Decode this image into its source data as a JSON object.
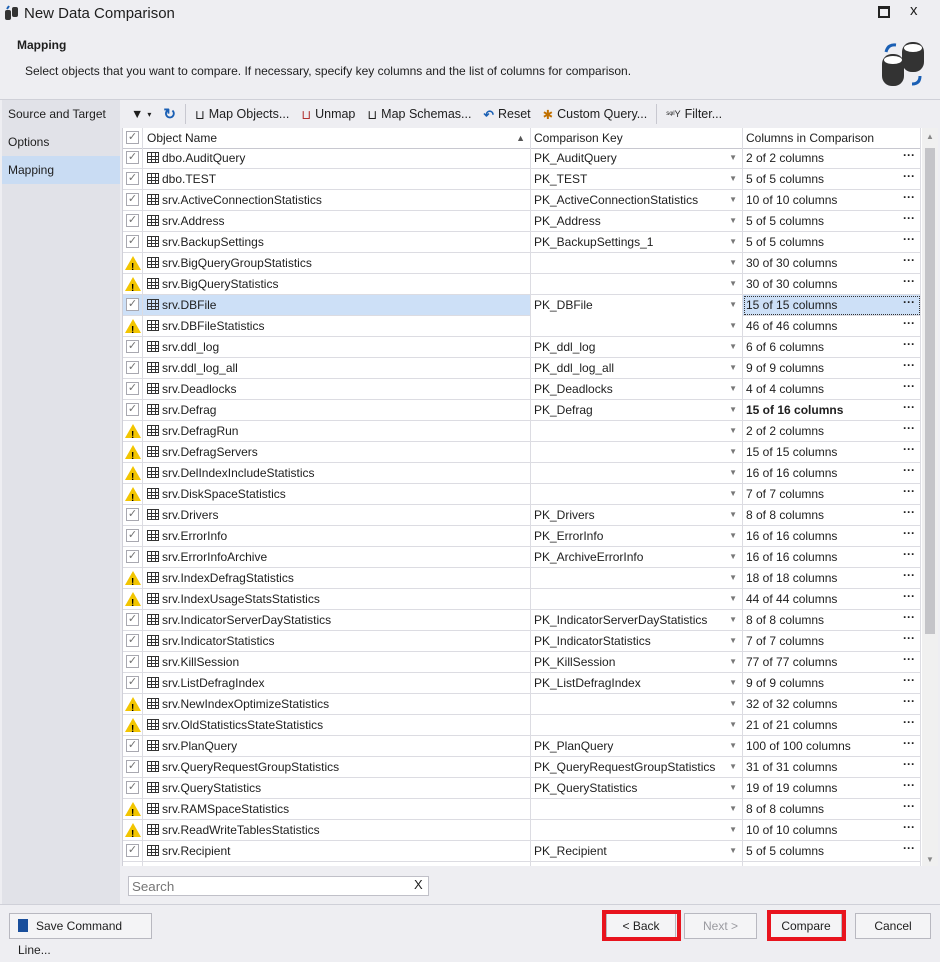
{
  "window": {
    "title": "New Data Comparison"
  },
  "header": {
    "section": "Mapping",
    "description": "Select objects that you want to compare. If necessary, specify key columns and the list of columns for comparison."
  },
  "nav": {
    "items": [
      {
        "label": "Source and Target"
      },
      {
        "label": "Options"
      },
      {
        "label": "Mapping",
        "selected": true
      }
    ]
  },
  "toolbar": {
    "map_objects": "Map Objects...",
    "unmap": "Unmap",
    "map_schemas": "Map Schemas...",
    "reset": "Reset",
    "custom_query": "Custom Query...",
    "filter": "Filter..."
  },
  "grid": {
    "columns": [
      "Object Name",
      "Comparison Key",
      "Columns in Comparison"
    ],
    "rows": [
      {
        "status": "checked",
        "name": "dbo.AuditQuery",
        "key": "PK_AuditQuery",
        "cols": "2 of 2 columns"
      },
      {
        "status": "checked",
        "name": "dbo.TEST",
        "key": "PK_TEST",
        "cols": "5 of 5 columns"
      },
      {
        "status": "checked",
        "name": "srv.ActiveConnectionStatistics",
        "key": "PK_ActiveConnectionStatistics",
        "cols": "10 of 10 columns"
      },
      {
        "status": "checked",
        "name": "srv.Address",
        "key": "PK_Address",
        "cols": "5 of 5 columns"
      },
      {
        "status": "checked",
        "name": "srv.BackupSettings",
        "key": "PK_BackupSettings_1",
        "cols": "5 of 5 columns"
      },
      {
        "status": "warning",
        "name": "srv.BigQueryGroupStatistics",
        "key": "",
        "cols": "30 of 30 columns"
      },
      {
        "status": "warning",
        "name": "srv.BigQueryStatistics",
        "key": "",
        "cols": "30 of 30 columns"
      },
      {
        "status": "checked",
        "name": "srv.DBFile",
        "key": "PK_DBFile",
        "cols": "15 of 15 columns",
        "selected": true
      },
      {
        "status": "warning",
        "name": "srv.DBFileStatistics",
        "key": "",
        "cols": "46 of 46 columns"
      },
      {
        "status": "checked",
        "name": "srv.ddl_log",
        "key": "PK_ddl_log",
        "cols": "6 of 6 columns"
      },
      {
        "status": "checked",
        "name": "srv.ddl_log_all",
        "key": "PK_ddl_log_all",
        "cols": "9 of 9 columns"
      },
      {
        "status": "checked",
        "name": "srv.Deadlocks",
        "key": "PK_Deadlocks",
        "cols": "4 of 4 columns"
      },
      {
        "status": "checked",
        "name": "srv.Defrag",
        "key": "PK_Defrag",
        "cols": "15 of 16 columns",
        "bold": true
      },
      {
        "status": "warning",
        "name": "srv.DefragRun",
        "key": "",
        "cols": "2 of 2 columns"
      },
      {
        "status": "warning",
        "name": "srv.DefragServers",
        "key": "",
        "cols": "15 of 15 columns"
      },
      {
        "status": "warning",
        "name": "srv.DelIndexIncludeStatistics",
        "key": "",
        "cols": "16 of 16 columns"
      },
      {
        "status": "warning",
        "name": "srv.DiskSpaceStatistics",
        "key": "",
        "cols": "7 of 7 columns"
      },
      {
        "status": "checked",
        "name": "srv.Drivers",
        "key": "PK_Drivers",
        "cols": "8 of 8 columns"
      },
      {
        "status": "checked",
        "name": "srv.ErrorInfo",
        "key": "PK_ErrorInfo",
        "cols": "16 of 16 columns"
      },
      {
        "status": "checked",
        "name": "srv.ErrorInfoArchive",
        "key": "PK_ArchiveErrorInfo",
        "cols": "16 of 16 columns"
      },
      {
        "status": "warning",
        "name": "srv.IndexDefragStatistics",
        "key": "",
        "cols": "18 of 18 columns"
      },
      {
        "status": "warning",
        "name": "srv.IndexUsageStatsStatistics",
        "key": "",
        "cols": "44 of 44 columns"
      },
      {
        "status": "checked",
        "name": "srv.IndicatorServerDayStatistics",
        "key": "PK_IndicatorServerDayStatistics",
        "cols": "8 of 8 columns"
      },
      {
        "status": "checked",
        "name": "srv.IndicatorStatistics",
        "key": "PK_IndicatorStatistics",
        "cols": "7 of 7 columns"
      },
      {
        "status": "checked",
        "name": "srv.KillSession",
        "key": "PK_KillSession",
        "cols": "77 of 77 columns"
      },
      {
        "status": "checked",
        "name": "srv.ListDefragIndex",
        "key": "PK_ListDefragIndex",
        "cols": "9 of 9 columns"
      },
      {
        "status": "warning",
        "name": "srv.NewIndexOptimizeStatistics",
        "key": "",
        "cols": "32 of 32 columns"
      },
      {
        "status": "warning",
        "name": "srv.OldStatisticsStateStatistics",
        "key": "",
        "cols": "21 of 21 columns"
      },
      {
        "status": "checked",
        "name": "srv.PlanQuery",
        "key": "PK_PlanQuery",
        "cols": "100 of 100 columns"
      },
      {
        "status": "checked",
        "name": "srv.QueryRequestGroupStatistics",
        "key": "PK_QueryRequestGroupStatistics",
        "cols": "31 of 31 columns"
      },
      {
        "status": "checked",
        "name": "srv.QueryStatistics",
        "key": "PK_QueryStatistics",
        "cols": "19 of 19 columns"
      },
      {
        "status": "warning",
        "name": "srv.RAMSpaceStatistics",
        "key": "",
        "cols": "8 of 8 columns"
      },
      {
        "status": "warning",
        "name": "srv.ReadWriteTablesStatistics",
        "key": "",
        "cols": "10 of 10 columns"
      },
      {
        "status": "checked",
        "name": "srv.Recipient",
        "key": "PK_Recipient",
        "cols": "5 of 5 columns"
      }
    ]
  },
  "search": {
    "placeholder": "Search"
  },
  "footer": {
    "save_cmd": "Save Command Line...",
    "back": "< Back",
    "next": "Next >",
    "compare": "Compare",
    "cancel": "Cancel"
  },
  "colors": {
    "selection": "#cde0f7",
    "highlight": "#e8141e",
    "warning": "#f2c500",
    "accent": "#1a5fb4"
  }
}
